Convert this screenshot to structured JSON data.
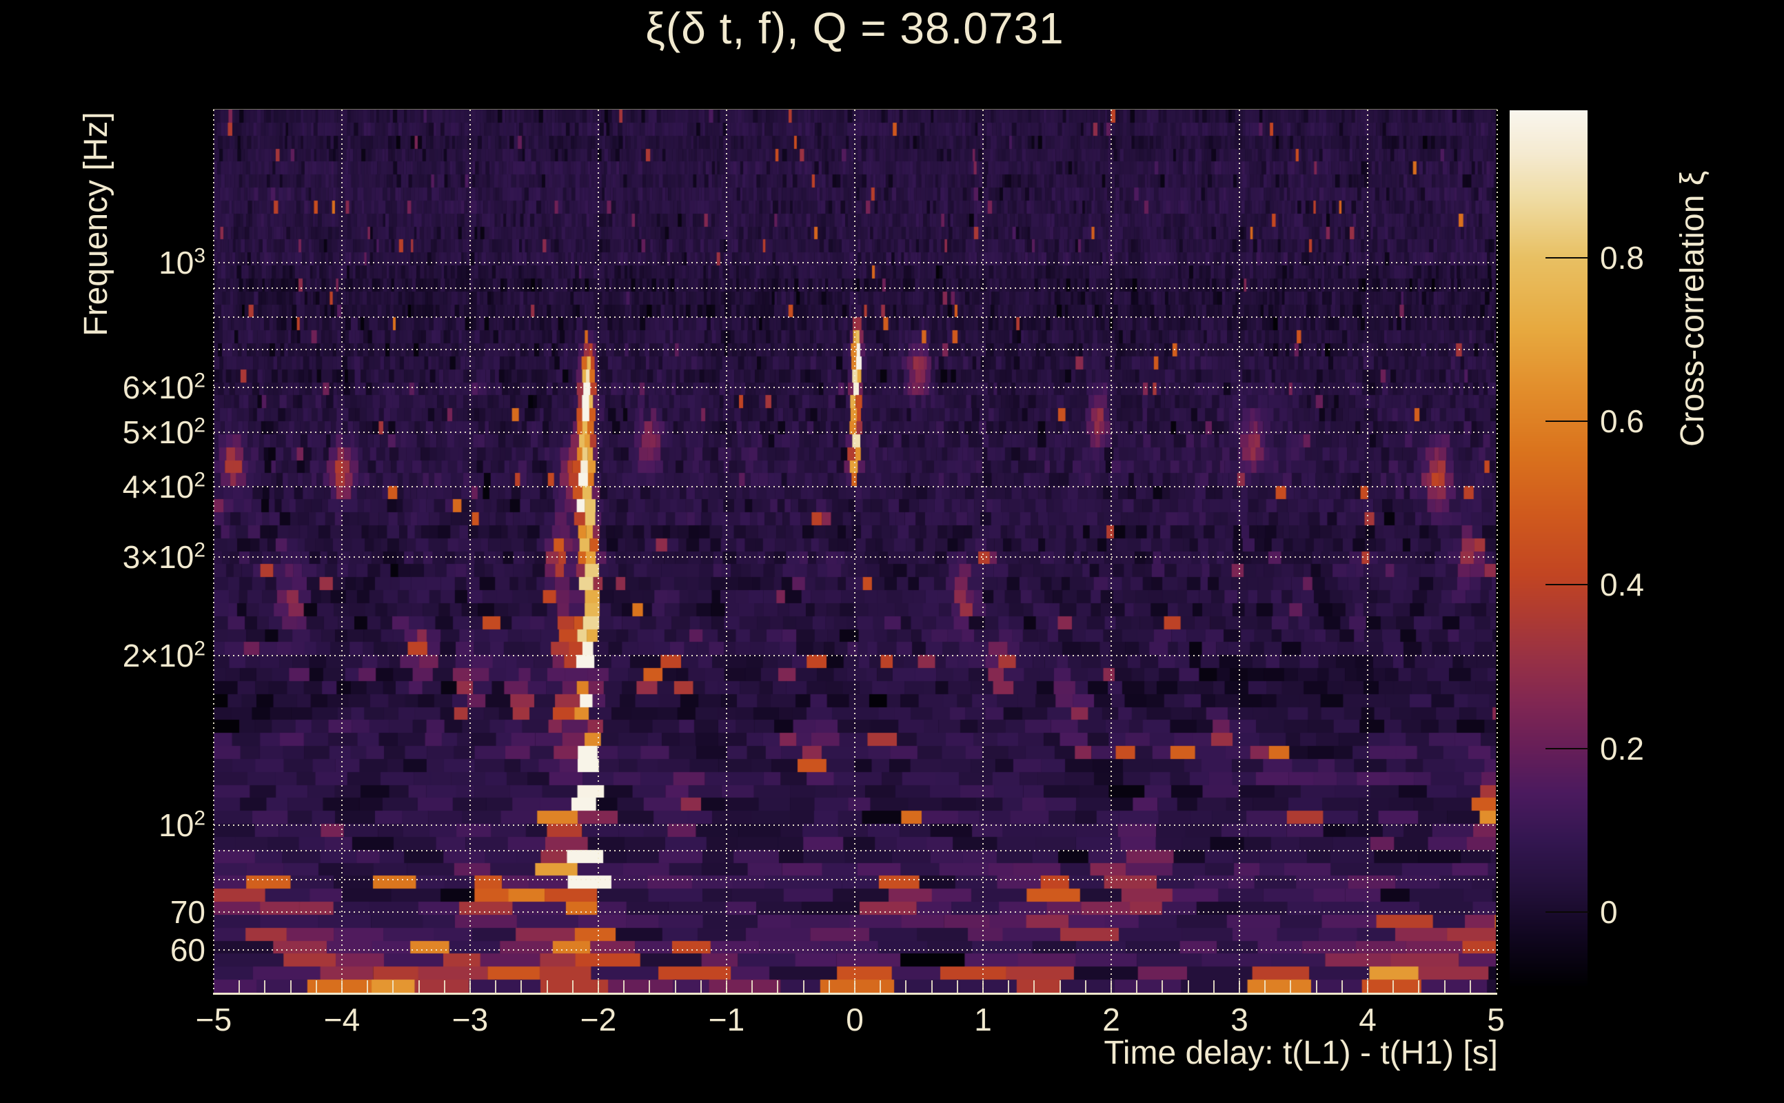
{
  "figure": {
    "title": "ξ(δ t, f), Q = 38.0731",
    "q_label": "38.0731",
    "background_color": "#000000",
    "text_color": "#f1e9cf",
    "grid_color": "#f3ecd4"
  },
  "axes": {
    "x": {
      "title": "Time delay: t(L1) - t(H1) [s]",
      "range": [
        -5,
        5
      ],
      "minor_tick_step": 0.2,
      "ticks": [
        {
          "label": "−5",
          "value": -5
        },
        {
          "label": "−4",
          "value": -4
        },
        {
          "label": "−3",
          "value": -3
        },
        {
          "label": "−2",
          "value": -2
        },
        {
          "label": "−1",
          "value": -1
        },
        {
          "label": "0",
          "value": 0
        },
        {
          "label": "1",
          "value": 1
        },
        {
          "label": "2",
          "value": 2
        },
        {
          "label": "3",
          "value": 3
        },
        {
          "label": "4",
          "value": 4
        },
        {
          "label": "5",
          "value": 5
        }
      ]
    },
    "y": {
      "title": "Frequency [Hz]",
      "scale": "log",
      "range_hz": [
        50.4,
        1871
      ],
      "ticks": [
        {
          "text": "10",
          "sup": "3",
          "hz": 1000
        },
        {
          "text": "6×10",
          "sup": "2",
          "hz": 600
        },
        {
          "text": "5×10",
          "sup": "2",
          "hz": 500
        },
        {
          "text": "4×10",
          "sup": "2",
          "hz": 400
        },
        {
          "text": "3×10",
          "sup": "2",
          "hz": 300
        },
        {
          "text": "2×10",
          "sup": "2",
          "hz": 200
        },
        {
          "text": "10",
          "sup": "2",
          "hz": 100
        },
        {
          "text": "70",
          "sup": "",
          "hz": 70
        },
        {
          "text": "60",
          "sup": "",
          "hz": 60
        }
      ],
      "gridline_hz": [
        60,
        70,
        80,
        90,
        100,
        200,
        300,
        400,
        500,
        600,
        700,
        800,
        900,
        1000
      ]
    },
    "colorbar": {
      "title": "Cross-correlation ξ",
      "range": [
        -0.09,
        0.98
      ],
      "ticks": [
        {
          "label": "0.8",
          "value": 0.8
        },
        {
          "label": "0.6",
          "value": 0.6
        },
        {
          "label": "0.4",
          "value": 0.4
        },
        {
          "label": "0.2",
          "value": 0.2
        },
        {
          "label": "0",
          "value": 0
        }
      ]
    }
  },
  "chart_data": {
    "type": "heatmap",
    "title": "ξ(δ t, f), Q = 38.0731",
    "xlabel": "Time delay: t(L1) - t(H1) [s]",
    "ylabel": "Frequency [Hz]",
    "zlabel": "Cross-correlation ξ",
    "q": 38.0731,
    "xlim": [
      -5,
      5
    ],
    "ylim_hz": [
      50.4,
      1871
    ],
    "log_y": true,
    "zlim": [
      -0.09,
      0.98
    ],
    "description": "Q-transform cross-correlation spectrogram: dark purple noise background with a bright gravitational-wave chirp track at time delay ≈ −2.1 s rising from 50 Hz to ~650 Hz (white-hot below 250 Hz), a fainter orange counterpart streak at delay ≈ 0 s between ~420 and 750 Hz, and scattered orange noise blobs concentrated below 90 Hz.",
    "colormap_anchors": [
      [
        0.0,
        "#000002"
      ],
      [
        0.055,
        "#10061f"
      ],
      [
        0.11,
        "#23103a"
      ],
      [
        0.165,
        "#331650"
      ],
      [
        0.22,
        "#4b1a5e"
      ],
      [
        0.27,
        "#661e58"
      ],
      [
        0.32,
        "#7f2653"
      ],
      [
        0.37,
        "#963046"
      ],
      [
        0.42,
        "#ad3a33"
      ],
      [
        0.47,
        "#c24522"
      ],
      [
        0.54,
        "#d05a1d"
      ],
      [
        0.61,
        "#da731d"
      ],
      [
        0.68,
        "#e28d2b"
      ],
      [
        0.75,
        "#e7a93f"
      ],
      [
        0.832,
        "#e8c063"
      ],
      [
        0.9,
        "#efdca4"
      ],
      [
        0.95,
        "#f5ead0"
      ],
      [
        1.0,
        "#f9f6ee"
      ]
    ],
    "features": {
      "chirp_track": {
        "sigma_t": 0.03,
        "sigma_lnf": 0.075,
        "points_t_hz_xi": [
          [
            -2.07,
            52,
            0.88
          ],
          [
            -2.1,
            57,
            0.82
          ],
          [
            -2.06,
            63,
            0.8
          ],
          [
            -2.09,
            70,
            0.92
          ],
          [
            -2.08,
            78,
            0.95
          ],
          [
            -2.1,
            86,
            0.93
          ],
          [
            -2.06,
            95,
            0.9
          ],
          [
            -2.08,
            105,
            0.95
          ],
          [
            -2.1,
            118,
            0.92
          ],
          [
            -2.07,
            132,
            0.88
          ],
          [
            -2.11,
            148,
            0.85
          ],
          [
            -2.06,
            165,
            0.9
          ],
          [
            -2.09,
            185,
            0.88
          ],
          [
            -2.12,
            207,
            0.8
          ],
          [
            -2.05,
            230,
            0.75
          ],
          [
            -2.1,
            258,
            0.78
          ],
          [
            -2.04,
            288,
            0.7
          ],
          [
            -2.11,
            322,
            0.72
          ],
          [
            -2.06,
            360,
            0.66
          ],
          [
            -2.12,
            400,
            0.7
          ],
          [
            -2.07,
            445,
            0.64
          ],
          [
            -2.13,
            495,
            0.58
          ],
          [
            -2.08,
            550,
            0.66
          ],
          [
            -2.1,
            605,
            0.58
          ],
          [
            -2.07,
            650,
            0.5
          ]
        ]
      },
      "chirp_side_blobs": {
        "sigma_t": 0.06,
        "sigma_lnf": 0.09,
        "points_t_hz_xi": [
          [
            -2.32,
            95,
            0.4
          ],
          [
            -2.27,
            150,
            0.45
          ],
          [
            -2.24,
            210,
            0.48
          ],
          [
            -2.3,
            300,
            0.35
          ],
          [
            -2.2,
            420,
            0.33
          ],
          [
            -2.42,
            57,
            0.5
          ],
          [
            -1.93,
            54,
            0.45
          ],
          [
            -2.22,
            60,
            0.5
          ]
        ]
      },
      "counterpart_t0_streak": {
        "sigma_t": 0.022,
        "sigma_lnf": 0.05,
        "points_t_hz_xi": [
          [
            0.01,
            745,
            0.45
          ],
          [
            0.02,
            700,
            0.58
          ],
          [
            0.02,
            655,
            0.68
          ],
          [
            0.01,
            612,
            0.52
          ],
          [
            0.0,
            565,
            0.66
          ],
          [
            0.01,
            522,
            0.46
          ],
          [
            0.0,
            482,
            0.58
          ],
          [
            0.01,
            448,
            0.5
          ],
          [
            0.0,
            422,
            0.4
          ]
        ]
      },
      "noise_blobs": {
        "sigma_t": 0.06,
        "sigma_lnf": 0.085,
        "points_t_hz_xi": [
          [
            -4.75,
            80,
            0.38
          ],
          [
            -4.55,
            60,
            0.42
          ],
          [
            -4.3,
            56,
            0.38
          ],
          [
            -4.05,
            53,
            0.5
          ],
          [
            -3.8,
            58,
            0.45
          ],
          [
            -3.6,
            51,
            0.55
          ],
          [
            -3.3,
            52,
            0.52
          ],
          [
            -3.05,
            53,
            0.5
          ],
          [
            -2.85,
            76,
            0.42
          ],
          [
            -2.62,
            55,
            0.45
          ],
          [
            -1.55,
            52,
            0.45
          ],
          [
            -1.25,
            58,
            0.42
          ],
          [
            -0.95,
            53,
            0.45
          ],
          [
            -0.6,
            52,
            0.38
          ],
          [
            -0.15,
            53,
            0.42
          ],
          [
            0.05,
            52,
            0.55
          ],
          [
            0.3,
            78,
            0.45
          ],
          [
            0.95,
            58,
            0.38
          ],
          [
            1.4,
            54,
            0.38
          ],
          [
            1.55,
            76,
            0.4
          ],
          [
            2.2,
            73,
            0.52
          ],
          [
            2.6,
            58,
            0.38
          ],
          [
            3.3,
            51,
            0.5
          ],
          [
            3.6,
            56,
            0.35
          ],
          [
            4.17,
            53,
            0.42
          ],
          [
            4.37,
            60,
            0.52
          ],
          [
            4.6,
            56,
            0.45
          ],
          [
            4.85,
            60,
            0.42
          ],
          [
            4.95,
            108,
            0.42
          ],
          [
            -4.0,
            420,
            0.32
          ],
          [
            -3.4,
            200,
            0.36
          ],
          [
            -3.0,
            180,
            0.33
          ],
          [
            -2.6,
            160,
            0.3
          ],
          [
            -1.3,
            110,
            0.3
          ],
          [
            -0.3,
            140,
            0.3
          ],
          [
            0.5,
            640,
            0.28
          ],
          [
            0.85,
            250,
            0.3
          ],
          [
            1.15,
            190,
            0.33
          ],
          [
            1.7,
            165,
            0.3
          ],
          [
            2.3,
            95,
            0.35
          ],
          [
            2.9,
            140,
            0.3
          ],
          [
            3.9,
            60,
            0.3
          ],
          [
            4.55,
            420,
            0.35
          ],
          [
            4.8,
            300,
            0.3
          ],
          [
            -4.4,
            250,
            0.3
          ],
          [
            -4.85,
            430,
            0.3
          ],
          [
            1.9,
            520,
            0.25
          ],
          [
            3.1,
            480,
            0.25
          ],
          [
            -1.6,
            480,
            0.25
          ]
        ]
      }
    },
    "noise_model": {
      "seed": 42,
      "rows": 68,
      "base_xi_by_band_hz": [
        [
          58,
          0.075
        ],
        [
          85,
          0.08
        ],
        [
          150,
          0.055
        ],
        [
          190,
          0.02
        ],
        [
          300,
          0.045
        ],
        [
          340,
          0.03
        ],
        [
          600,
          0.05
        ],
        [
          700,
          0.04
        ],
        [
          1000,
          0.025
        ],
        [
          1900,
          0.045
        ]
      ],
      "speckle_prob_by_band_hz": [
        [
          90,
          0.07
        ],
        [
          160,
          0.045
        ],
        [
          400,
          0.03
        ],
        [
          1900,
          0.018
        ]
      ]
    }
  }
}
